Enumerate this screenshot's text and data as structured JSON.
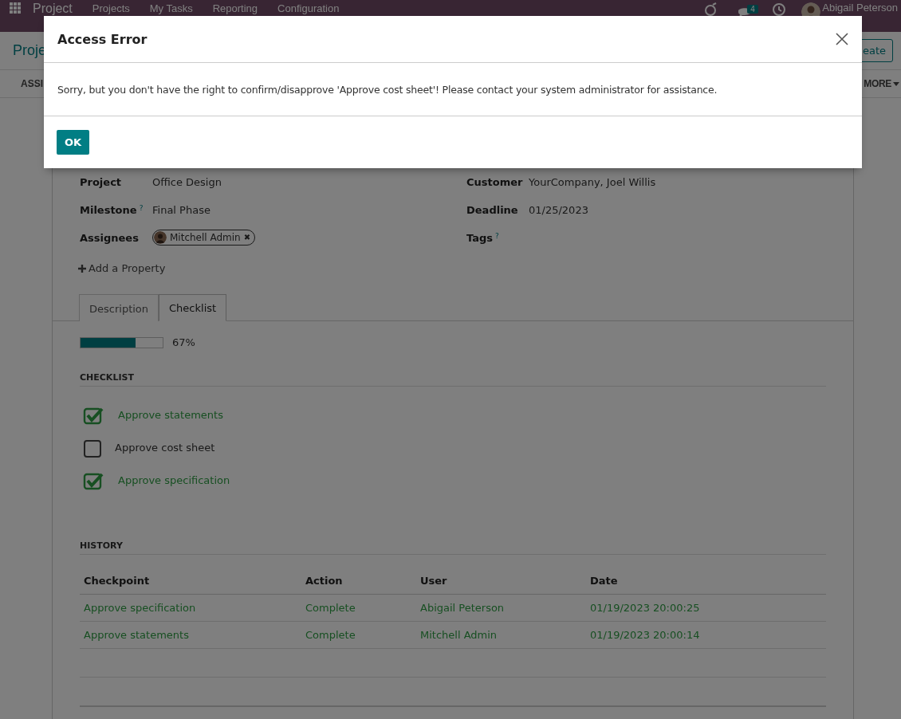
{
  "navbar": {
    "brand": "Project",
    "menu": [
      "Projects",
      "My Tasks",
      "Reporting",
      "Configuration"
    ],
    "message_count": "4",
    "user": "Abigail Peterson"
  },
  "control_panel": {
    "breadcrumb": "Proje",
    "create_button": "eate",
    "stage_button": "ASSI",
    "more_button": "MORE"
  },
  "form": {
    "left_fields": [
      {
        "label": "Project",
        "value": "Office Design"
      },
      {
        "label": "Milestone",
        "help_mark": "?",
        "value": "Final Phase"
      },
      {
        "label": "Assignees",
        "tag": "Mitchell Admin",
        "tag_remove": "✖"
      }
    ],
    "right_fields": [
      {
        "label": "Customer",
        "value": "YourCompany, Joel Willis"
      },
      {
        "label": "Deadline",
        "value": "01/25/2023"
      },
      {
        "label": "Tags",
        "help_mark": "?"
      }
    ],
    "add_property": "Add a Property",
    "tabs": [
      {
        "label": "Description",
        "selected": false
      },
      {
        "label": "Checklist",
        "selected": true
      }
    ],
    "progress": {
      "level": 0.67,
      "reading": "67%"
    },
    "checklist": {
      "heading": "CHECKLIST",
      "items": [
        {
          "label": "Approve statements",
          "checked": true
        },
        {
          "label": "Approve cost sheet",
          "checked": false
        },
        {
          "label": "Approve specification",
          "checked": true
        }
      ]
    },
    "history": {
      "heading": "HISTORY",
      "columns": [
        "Checkpoint",
        "Action",
        "User",
        "Date"
      ],
      "rows": [
        [
          "Approve specification",
          "Complete",
          "Abigail Peterson",
          "01/19/2023 20:00:25"
        ],
        [
          "Approve statements",
          "Complete",
          "Mitchell Admin",
          "01/19/2023 20:00:14"
        ]
      ]
    }
  },
  "dialog": {
    "title": "Access Error",
    "message": "Sorry, but you don't have the right to confirm/disapprove 'Approve cost sheet'! Please contact your system administrator for assistance.",
    "button": "OK"
  }
}
